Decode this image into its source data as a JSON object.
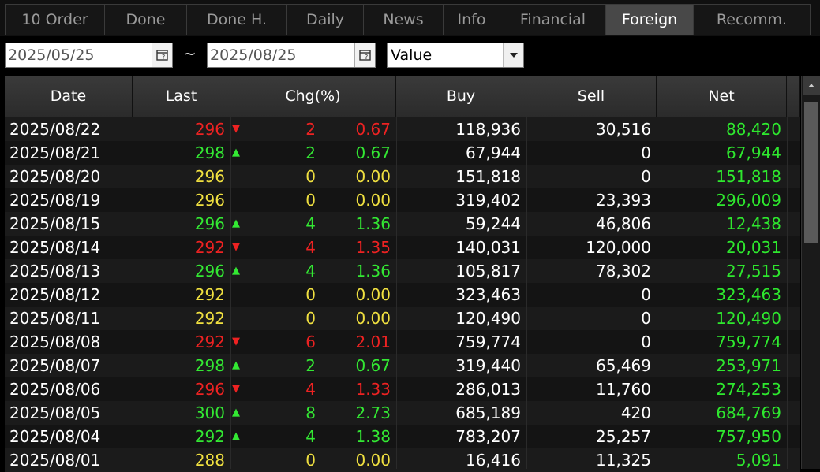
{
  "tabs": [
    {
      "label": "10 Order",
      "width": 126
    },
    {
      "label": "Done",
      "width": 104
    },
    {
      "label": "Done H.",
      "width": 127
    },
    {
      "label": "Daily",
      "width": 97
    },
    {
      "label": "News",
      "width": 101
    },
    {
      "label": "Info",
      "width": 72
    },
    {
      "label": "Financial",
      "width": 134
    },
    {
      "label": "Foreign",
      "width": 111,
      "active": true
    },
    {
      "label": "Recomm.",
      "width": 149
    }
  ],
  "filter": {
    "start_date": "2025/05/25",
    "separator": "~",
    "end_date": "2025/08/25",
    "type_selected": "Value"
  },
  "table": {
    "headers": [
      "Date",
      "Last",
      "Chg(%)",
      "Buy",
      "Sell",
      "Net"
    ],
    "rows": [
      {
        "date": "2025/08/22",
        "last": "296",
        "dir": "down",
        "chg": "2",
        "pct": "0.67",
        "buy": "118,936",
        "sell": "30,516",
        "net": "88,420"
      },
      {
        "date": "2025/08/21",
        "last": "298",
        "dir": "up",
        "chg": "2",
        "pct": "0.67",
        "buy": "67,944",
        "sell": "0",
        "net": "67,944"
      },
      {
        "date": "2025/08/20",
        "last": "296",
        "dir": "flat",
        "chg": "0",
        "pct": "0.00",
        "buy": "151,818",
        "sell": "0",
        "net": "151,818"
      },
      {
        "date": "2025/08/19",
        "last": "296",
        "dir": "flat",
        "chg": "0",
        "pct": "0.00",
        "buy": "319,402",
        "sell": "23,393",
        "net": "296,009"
      },
      {
        "date": "2025/08/15",
        "last": "296",
        "dir": "up",
        "chg": "4",
        "pct": "1.36",
        "buy": "59,244",
        "sell": "46,806",
        "net": "12,438"
      },
      {
        "date": "2025/08/14",
        "last": "292",
        "dir": "down",
        "chg": "4",
        "pct": "1.35",
        "buy": "140,031",
        "sell": "120,000",
        "net": "20,031"
      },
      {
        "date": "2025/08/13",
        "last": "296",
        "dir": "up",
        "chg": "4",
        "pct": "1.36",
        "buy": "105,817",
        "sell": "78,302",
        "net": "27,515"
      },
      {
        "date": "2025/08/12",
        "last": "292",
        "dir": "flat",
        "chg": "0",
        "pct": "0.00",
        "buy": "323,463",
        "sell": "0",
        "net": "323,463"
      },
      {
        "date": "2025/08/11",
        "last": "292",
        "dir": "flat",
        "chg": "0",
        "pct": "0.00",
        "buy": "120,490",
        "sell": "0",
        "net": "120,490"
      },
      {
        "date": "2025/08/08",
        "last": "292",
        "dir": "down",
        "chg": "6",
        "pct": "2.01",
        "buy": "759,774",
        "sell": "0",
        "net": "759,774"
      },
      {
        "date": "2025/08/07",
        "last": "298",
        "dir": "up",
        "chg": "2",
        "pct": "0.67",
        "buy": "319,440",
        "sell": "65,469",
        "net": "253,971"
      },
      {
        "date": "2025/08/06",
        "last": "296",
        "dir": "down",
        "chg": "4",
        "pct": "1.33",
        "buy": "286,013",
        "sell": "11,760",
        "net": "274,253"
      },
      {
        "date": "2025/08/05",
        "last": "300",
        "dir": "up",
        "chg": "8",
        "pct": "2.73",
        "buy": "685,189",
        "sell": "420",
        "net": "684,769"
      },
      {
        "date": "2025/08/04",
        "last": "292",
        "dir": "up",
        "chg": "4",
        "pct": "1.38",
        "buy": "783,207",
        "sell": "25,257",
        "net": "757,950"
      },
      {
        "date": "2025/08/01",
        "last": "288",
        "dir": "flat",
        "chg": "0",
        "pct": "0.00",
        "buy": "16,416",
        "sell": "11,325",
        "net": "5,091"
      }
    ]
  },
  "colors": {
    "up": "#33e833",
    "down": "#ee2222",
    "flat": "#f0e040",
    "net": "#2ee82e"
  },
  "icons": {
    "calendar": "calendar-icon",
    "dropdown": "chevron-down-icon",
    "up": "triangle-up-icon",
    "down": "triangle-down-icon"
  }
}
